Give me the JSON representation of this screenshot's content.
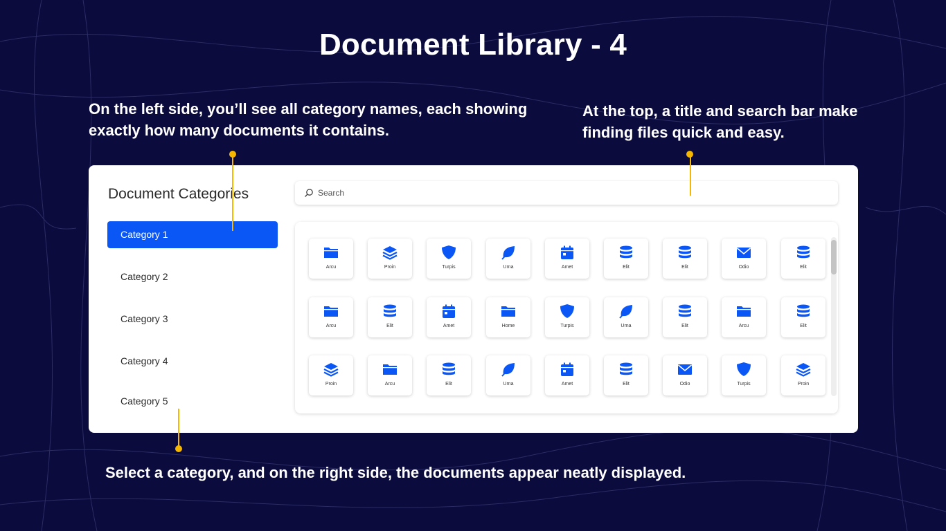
{
  "slide": {
    "title": "Document Library - 4",
    "note_left": "On the left side, you’ll see all category names, each showing exactly how many documents it contains.",
    "note_right": "At the top, a title and search bar make finding files quick and easy.",
    "note_bottom": "Select a category, and on the right side, the documents appear neatly displayed."
  },
  "colors": {
    "background": "#0b0b3d",
    "accent": "#0b57f5",
    "callout": "#f5b700"
  },
  "sidebar": {
    "heading": "Document Categories",
    "selected": "Category 1",
    "items": [
      {
        "label": "Category 1"
      },
      {
        "label": "Category 2"
      },
      {
        "label": "Category 3"
      },
      {
        "label": "Category 4"
      },
      {
        "label": "Category 5"
      }
    ]
  },
  "search": {
    "placeholder": "Search",
    "icon": "search-icon"
  },
  "documents": [
    {
      "label": "Arcu",
      "icon": "folder"
    },
    {
      "label": "Proin",
      "icon": "layers"
    },
    {
      "label": "Turpis",
      "icon": "shield"
    },
    {
      "label": "Urna",
      "icon": "leaf"
    },
    {
      "label": "Amet",
      "icon": "calendar"
    },
    {
      "label": "Elit",
      "icon": "database"
    },
    {
      "label": "Elit",
      "icon": "database"
    },
    {
      "label": "Odio",
      "icon": "mail"
    },
    {
      "label": "Elit",
      "icon": "database"
    },
    {
      "label": "Arcu",
      "icon": "folder"
    },
    {
      "label": "Elit",
      "icon": "database"
    },
    {
      "label": "Amet",
      "icon": "calendar"
    },
    {
      "label": "Home",
      "icon": "folder"
    },
    {
      "label": "Turpis",
      "icon": "shield"
    },
    {
      "label": "Urna",
      "icon": "leaf"
    },
    {
      "label": "Elit",
      "icon": "database"
    },
    {
      "label": "Arcu",
      "icon": "folder"
    },
    {
      "label": "Elit",
      "icon": "database"
    },
    {
      "label": "Proin",
      "icon": "layers"
    },
    {
      "label": "Arcu",
      "icon": "folder"
    },
    {
      "label": "Elit",
      "icon": "database"
    },
    {
      "label": "Urna",
      "icon": "leaf"
    },
    {
      "label": "Amet",
      "icon": "calendar"
    },
    {
      "label": "Elit",
      "icon": "database"
    },
    {
      "label": "Odio",
      "icon": "mail"
    },
    {
      "label": "Turpis",
      "icon": "shield"
    },
    {
      "label": "Proin",
      "icon": "layers"
    }
  ]
}
